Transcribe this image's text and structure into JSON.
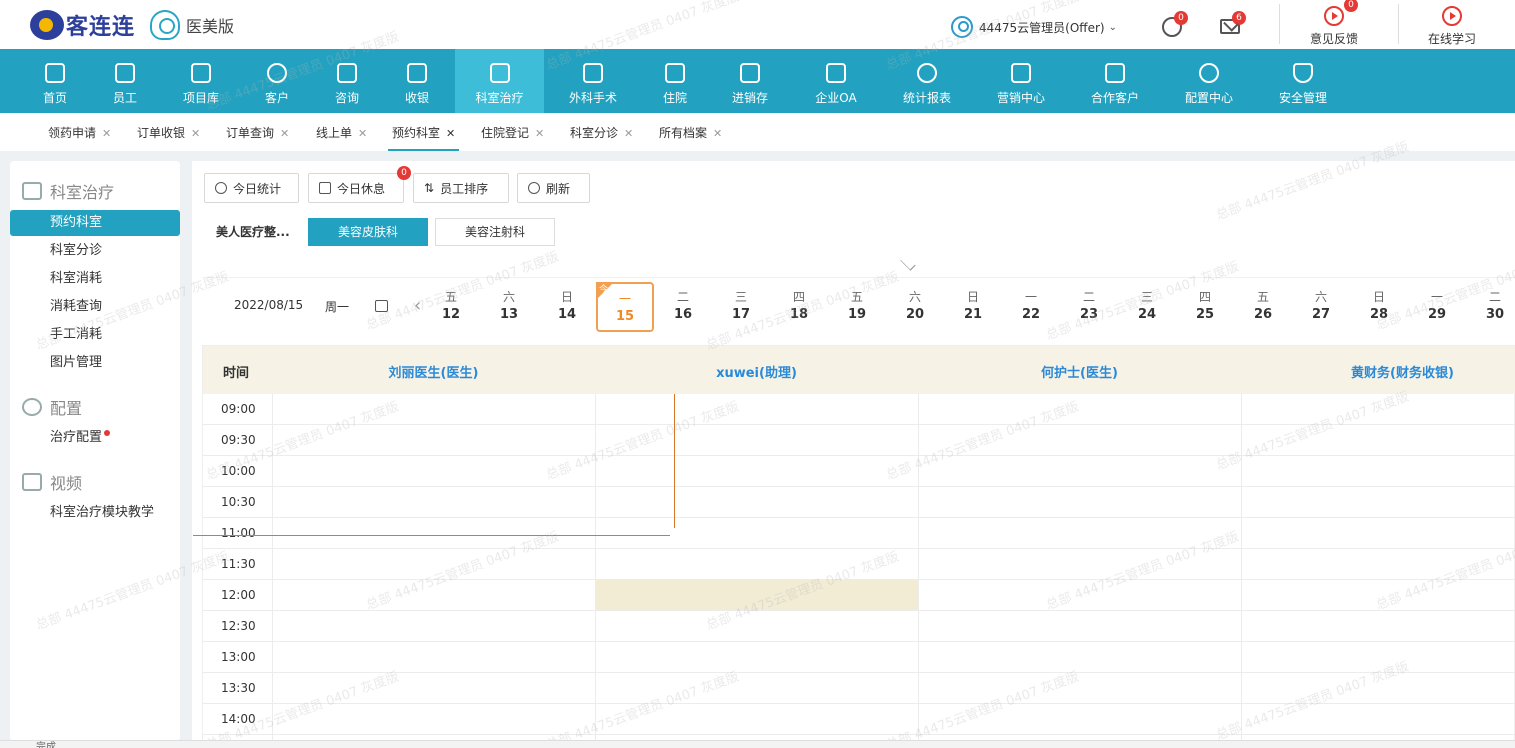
{
  "brand": {
    "logo_text": "客连连",
    "edition": "医美版"
  },
  "user": {
    "name": "44475云管理员(Offer)"
  },
  "badges": {
    "chat": "0",
    "mail": "6",
    "feedback": "0",
    "rest": "0"
  },
  "top_links": [
    {
      "label": "意见反馈"
    },
    {
      "label": "在线学习"
    }
  ],
  "nav": [
    {
      "label": "首页"
    },
    {
      "label": "员工"
    },
    {
      "label": "项目库"
    },
    {
      "label": "客户"
    },
    {
      "label": "咨询"
    },
    {
      "label": "收银"
    },
    {
      "label": "科室治疗"
    },
    {
      "label": "外科手术"
    },
    {
      "label": "住院"
    },
    {
      "label": "进销存"
    },
    {
      "label": "企业OA"
    },
    {
      "label": "统计报表"
    },
    {
      "label": "营销中心"
    },
    {
      "label": "合作客户"
    },
    {
      "label": "配置中心"
    },
    {
      "label": "安全管理"
    }
  ],
  "tabs": [
    {
      "label": "领药申请"
    },
    {
      "label": "订单收银"
    },
    {
      "label": "订单查询"
    },
    {
      "label": "线上单"
    },
    {
      "label": "预约科室"
    },
    {
      "label": "住院登记"
    },
    {
      "label": "科室分诊"
    },
    {
      "label": "所有档案"
    }
  ],
  "sidebar": {
    "sections": [
      {
        "title": "科室治疗",
        "items": [
          "预约科室",
          "科室分诊",
          "科室消耗",
          "消耗查询",
          "手工消耗",
          "图片管理"
        ]
      },
      {
        "title": "配置",
        "items": [
          "治疗配置"
        ]
      },
      {
        "title": "视频",
        "items": [
          "科室治疗模块教学"
        ]
      }
    ]
  },
  "toolbar": {
    "today_stats": "今日统计",
    "today_rest": "今日休息",
    "staff_sort": "员工排序",
    "refresh": "刷新"
  },
  "dept": {
    "org": "美人医疗整...",
    "chips": [
      "美容皮肤科",
      "美容注射科"
    ]
  },
  "datebar": {
    "date": "2022/08/15",
    "weekday": "周一",
    "today_flag": "今",
    "days": [
      {
        "wd": "五",
        "dn": "12"
      },
      {
        "wd": "六",
        "dn": "13"
      },
      {
        "wd": "日",
        "dn": "14"
      },
      {
        "wd": "一",
        "dn": "15"
      },
      {
        "wd": "二",
        "dn": "16"
      },
      {
        "wd": "三",
        "dn": "17"
      },
      {
        "wd": "四",
        "dn": "18"
      },
      {
        "wd": "五",
        "dn": "19"
      },
      {
        "wd": "六",
        "dn": "20"
      },
      {
        "wd": "日",
        "dn": "21"
      },
      {
        "wd": "一",
        "dn": "22"
      },
      {
        "wd": "二",
        "dn": "23"
      },
      {
        "wd": "三",
        "dn": "24"
      },
      {
        "wd": "四",
        "dn": "25"
      },
      {
        "wd": "五",
        "dn": "26"
      },
      {
        "wd": "六",
        "dn": "27"
      },
      {
        "wd": "日",
        "dn": "28"
      },
      {
        "wd": "一",
        "dn": "29"
      },
      {
        "wd": "二",
        "dn": "30"
      }
    ]
  },
  "schedule": {
    "time_header": "时间",
    "staff": [
      "刘丽医生(医生)",
      "xuwei(助理)",
      "何护士(医生)",
      "黄财务(财务收银)"
    ],
    "times": [
      "09:00",
      "09:30",
      "10:00",
      "10:30",
      "11:00",
      "11:30",
      "12:00",
      "12:30",
      "13:00",
      "13:30",
      "14:00"
    ]
  },
  "watermark": "总部 44475云管理员 0407 灰度版",
  "status": {
    "text": "完成"
  },
  "colors": {
    "primary": "#22a2c0",
    "accent": "#f0a050",
    "badge": "#e53935"
  }
}
